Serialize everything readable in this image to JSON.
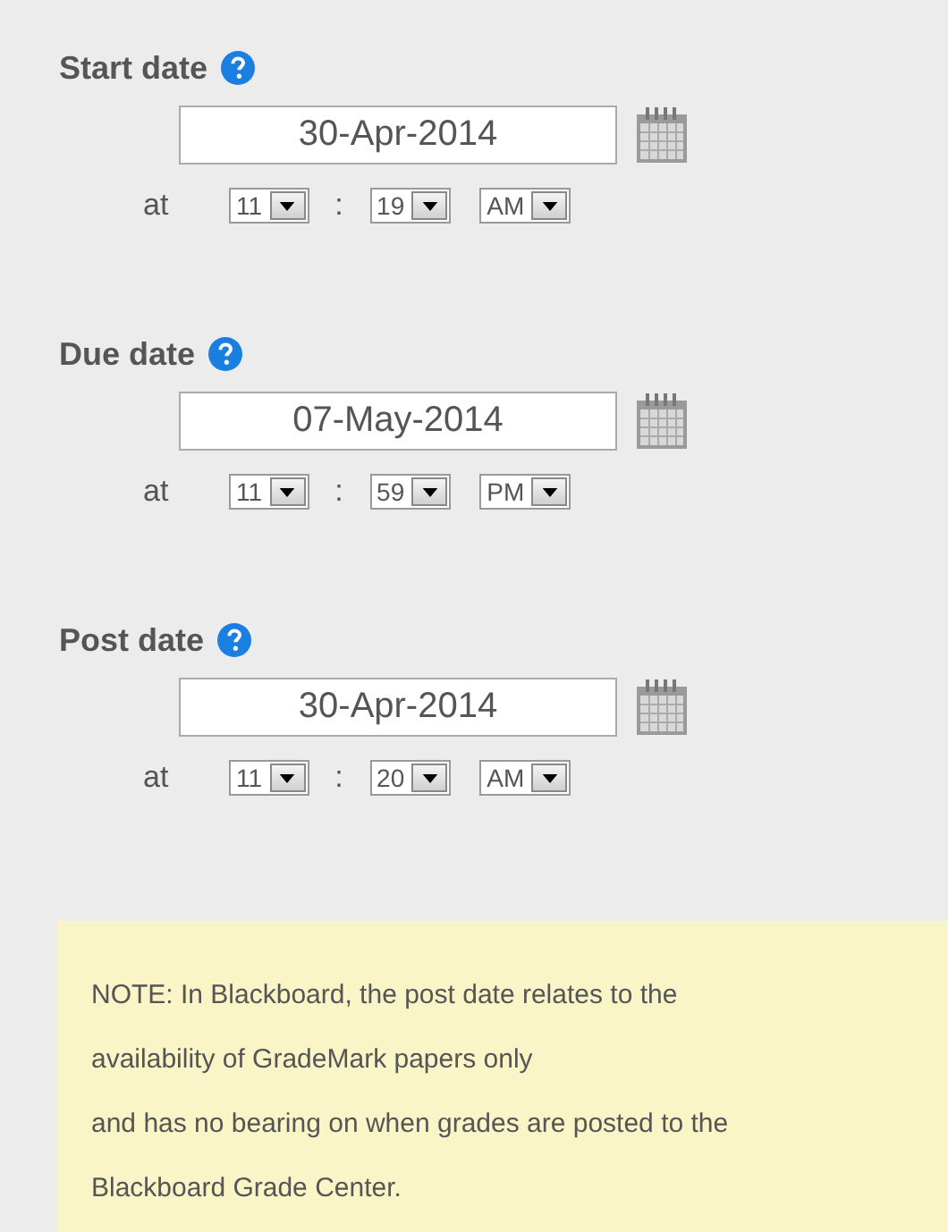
{
  "date_fields": [
    {
      "label": "Start date",
      "date": "30-Apr-2014",
      "at": "at",
      "hour": "11",
      "separator": ":",
      "minute": "19",
      "ampm": "AM"
    },
    {
      "label": "Due date",
      "date": "07-May-2014",
      "at": "at",
      "hour": "11",
      "separator": ":",
      "minute": "59",
      "ampm": "PM"
    },
    {
      "label": "Post date",
      "date": "30-Apr-2014",
      "at": "at",
      "hour": "11",
      "separator": ":",
      "minute": "20",
      "ampm": "AM"
    }
  ],
  "note": {
    "lines": [
      "NOTE: In Blackboard, the post date relates to the",
      "availability of GradeMark papers only",
      "and has no bearing on when grades are posted to the",
      "Blackboard Grade Center."
    ]
  }
}
